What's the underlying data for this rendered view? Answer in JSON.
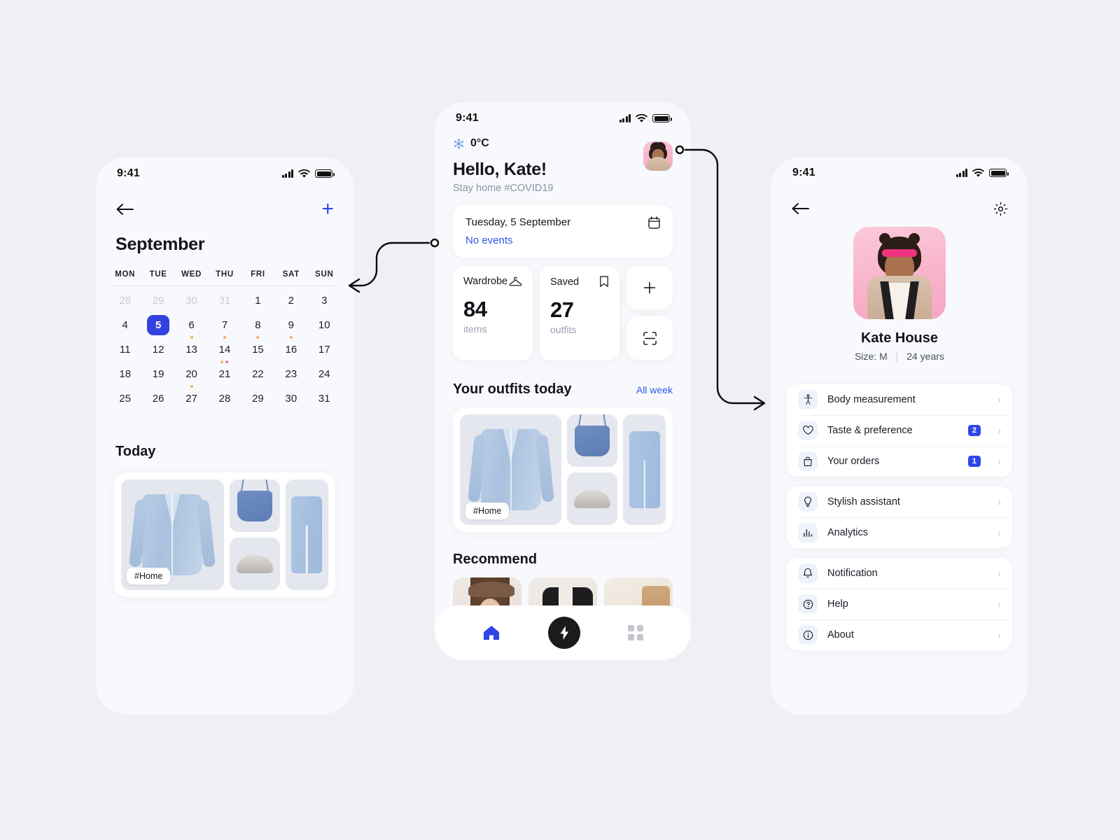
{
  "calendar_screen": {
    "status": {
      "time": "9:41"
    },
    "nav": {
      "back": "back-arrow",
      "add": "+"
    },
    "month": "September",
    "weekdays": [
      "MON",
      "TUE",
      "WED",
      "THU",
      "FRI",
      "SAT",
      "SUN"
    ],
    "days": [
      {
        "n": "28",
        "muted": true,
        "dots": []
      },
      {
        "n": "29",
        "muted": true,
        "dots": []
      },
      {
        "n": "30",
        "muted": true,
        "dots": []
      },
      {
        "n": "31",
        "muted": true,
        "dots": []
      },
      {
        "n": "1",
        "muted": false,
        "dots": []
      },
      {
        "n": "2",
        "muted": false,
        "dots": []
      },
      {
        "n": "3",
        "muted": false,
        "dots": []
      },
      {
        "n": "4",
        "muted": false,
        "dots": []
      },
      {
        "n": "5",
        "muted": false,
        "selected": true,
        "dots": []
      },
      {
        "n": "6",
        "muted": false,
        "dots": [
          "orange"
        ]
      },
      {
        "n": "7",
        "muted": false,
        "dots": [
          "orange"
        ]
      },
      {
        "n": "8",
        "muted": false,
        "dots": [
          "orange"
        ]
      },
      {
        "n": "9",
        "muted": false,
        "dots": [
          "orange"
        ]
      },
      {
        "n": "10",
        "muted": false,
        "dots": []
      },
      {
        "n": "11",
        "muted": false,
        "dots": []
      },
      {
        "n": "12",
        "muted": false,
        "dots": []
      },
      {
        "n": "13",
        "muted": false,
        "dots": []
      },
      {
        "n": "14",
        "muted": false,
        "dots": [
          "orange",
          "pink"
        ]
      },
      {
        "n": "15",
        "muted": false,
        "dots": []
      },
      {
        "n": "16",
        "muted": false,
        "dots": []
      },
      {
        "n": "17",
        "muted": false,
        "dots": []
      },
      {
        "n": "18",
        "muted": false,
        "dots": []
      },
      {
        "n": "19",
        "muted": false,
        "dots": []
      },
      {
        "n": "20",
        "muted": false,
        "dots": [
          "orange"
        ]
      },
      {
        "n": "21",
        "muted": false,
        "dots": []
      },
      {
        "n": "22",
        "muted": false,
        "dots": []
      },
      {
        "n": "23",
        "muted": false,
        "dots": []
      },
      {
        "n": "24",
        "muted": false,
        "dots": []
      },
      {
        "n": "25",
        "muted": false,
        "dots": []
      },
      {
        "n": "26",
        "muted": false,
        "dots": []
      },
      {
        "n": "27",
        "muted": false,
        "dots": []
      },
      {
        "n": "28",
        "muted": false,
        "dots": []
      },
      {
        "n": "29",
        "muted": false,
        "dots": []
      },
      {
        "n": "30",
        "muted": false,
        "dots": []
      },
      {
        "n": "31",
        "muted": false,
        "dots": []
      }
    ],
    "today_label": "Today",
    "outfit_tag": "#Home",
    "outfit_items": [
      "pajama-shirt",
      "camisole-top",
      "slipper",
      "pajama-pants"
    ]
  },
  "home_screen": {
    "status": {
      "time": "9:41"
    },
    "weather": {
      "icon": "snowflake-icon",
      "temperature": "0°C"
    },
    "greeting": "Hello, Kate!",
    "subtitle": "Stay home #COVID19",
    "avatar": "user-avatar",
    "event_card": {
      "date": "Tuesday, 5 September",
      "events": "No events",
      "icon": "calendar-icon"
    },
    "stats": [
      {
        "title": "Wardrobe",
        "icon": "hanger-icon",
        "value": "84",
        "unit": "items"
      },
      {
        "title": "Saved",
        "icon": "bookmark-icon",
        "value": "27",
        "unit": "outfits"
      }
    ],
    "quick_actions": [
      {
        "name": "add-button",
        "glyph": "+"
      },
      {
        "name": "scan-button",
        "glyph": "scan-icon"
      }
    ],
    "outfits_section": {
      "title": "Your outfits today",
      "link": "All week",
      "tag": "#Home",
      "items": [
        "pajama-shirt",
        "camisole-top",
        "slipper",
        "pajama-pants"
      ]
    },
    "recommend_section": {
      "title": "Recommend",
      "items": [
        "woman-in-hat",
        "black-coat",
        "tan-bag"
      ]
    },
    "tabbar": [
      {
        "name": "tab-home",
        "icon": "home-icon",
        "active": true
      },
      {
        "name": "tab-action",
        "icon": "bolt-icon",
        "active": false
      },
      {
        "name": "tab-grid",
        "icon": "grid-icon",
        "active": false
      }
    ]
  },
  "profile_screen": {
    "status": {
      "time": "9:41"
    },
    "nav": {
      "back": "back-arrow",
      "settings": "gear-icon"
    },
    "photo": "profile-photo",
    "name": "Kate House",
    "size_label": "Size: M",
    "divider": "|",
    "age": "24 years",
    "menu_groups": [
      {
        "items": [
          {
            "label": "Body measurement",
            "icon": "body-icon",
            "badge": ""
          },
          {
            "label": "Taste & preference",
            "icon": "heart-icon",
            "badge": "2"
          },
          {
            "label": "Your orders",
            "icon": "bag-icon",
            "badge": "1"
          }
        ]
      },
      {
        "items": [
          {
            "label": "Stylish assistant",
            "icon": "bulb-icon",
            "badge": ""
          },
          {
            "label": "Analytics",
            "icon": "chart-icon",
            "badge": ""
          }
        ]
      },
      {
        "items": [
          {
            "label": "Notification",
            "icon": "bell-icon",
            "badge": ""
          },
          {
            "label": "Help",
            "icon": "question-icon",
            "badge": ""
          },
          {
            "label": "About",
            "icon": "info-icon",
            "badge": ""
          }
        ]
      }
    ]
  },
  "colors": {
    "background": "#eef0f5",
    "phone_bg": "#f8f9fc",
    "accent_blue": "#2f46e8",
    "link_blue": "#2f56ea",
    "dot_orange": "#f0b45a",
    "dot_pink": "#f07ba0",
    "badge_blue": "#2f46e8"
  },
  "connectors": [
    {
      "name": "calendar-connector",
      "from": "home-event-card",
      "to": "calendar-screen"
    },
    {
      "name": "profile-connector",
      "from": "home-avatar",
      "to": "profile-screen"
    }
  ]
}
